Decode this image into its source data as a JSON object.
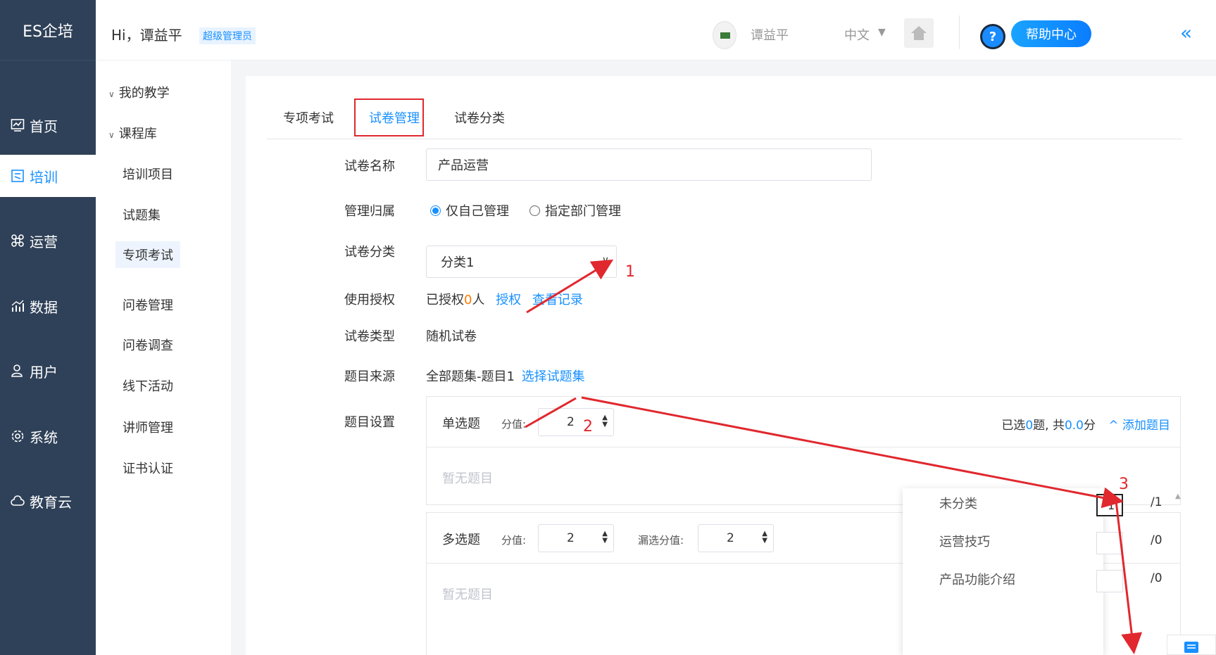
{
  "app": {
    "logo": "ES企培"
  },
  "sidebar": {
    "items": [
      {
        "label": "首页",
        "icon": "dashboard-icon"
      },
      {
        "label": "培训",
        "icon": "training-icon",
        "active": true
      },
      {
        "label": "运营",
        "icon": "command-icon"
      },
      {
        "label": "数据",
        "icon": "chart-icon"
      },
      {
        "label": "用户",
        "icon": "user-icon"
      },
      {
        "label": "系统",
        "icon": "gear-icon"
      },
      {
        "label": "教育云",
        "icon": "cloud-icon"
      }
    ]
  },
  "header": {
    "greeting": "Hi，谭益平",
    "role": "超级管理员",
    "username": "谭益平",
    "language": "中文",
    "help": "帮助中心",
    "help_icon_text": "?"
  },
  "submenu": {
    "groups": [
      "我的教学",
      "课程库"
    ],
    "items": [
      "培训项目",
      "试题集",
      "专项考试",
      "问卷管理",
      "问卷调查",
      "线下活动",
      "讲师管理",
      "证书认证"
    ],
    "active": "专项考试"
  },
  "tabs": [
    "专项考试",
    "试卷管理",
    "试卷分类"
  ],
  "form": {
    "name_label": "试卷名称",
    "name_value": "产品运营",
    "ownership_label": "管理归属",
    "ownership_options": [
      "仅自己管理",
      "指定部门管理"
    ],
    "ownership_selected": "仅自己管理",
    "category_label": "试卷分类",
    "category_value": "分类1",
    "auth_label": "使用授权",
    "auth_prefix": "已授权",
    "auth_count": "0",
    "auth_suffix": "人",
    "auth_link": "授权",
    "auth_record_link": "查看记录",
    "type_label": "试卷类型",
    "type_value": "随机试卷",
    "source_label": "题目来源",
    "source_value": "全部题集-题目1",
    "source_link": "选择试题集",
    "settings_label": "题目设置"
  },
  "questions": {
    "single": {
      "type": "单选题",
      "score_label": "分值:",
      "score": "2",
      "empty": "暂无题目",
      "summary_prefix": "已选",
      "summary_count": "0",
      "summary_mid": "题, 共",
      "summary_total": "0.0",
      "summary_suffix": "分",
      "add": "添加题目"
    },
    "multi": {
      "type": "多选题",
      "score_label": "分值:",
      "score": "2",
      "miss_label": "漏选分值:",
      "miss_score": "2",
      "empty": "暂无题目"
    }
  },
  "popover": {
    "rows": [
      {
        "name": "未分类",
        "value": "1",
        "total": "/1"
      },
      {
        "name": "运营技巧",
        "value": "",
        "total": "/0"
      },
      {
        "name": "产品功能介绍",
        "value": "",
        "total": "/0"
      }
    ]
  },
  "annotations": [
    "1",
    "2",
    "3"
  ],
  "colors": {
    "sidebar": "#2f4158",
    "accent": "#1890ff",
    "annotation": "#e0282e",
    "highlight": "#ff7a00"
  }
}
